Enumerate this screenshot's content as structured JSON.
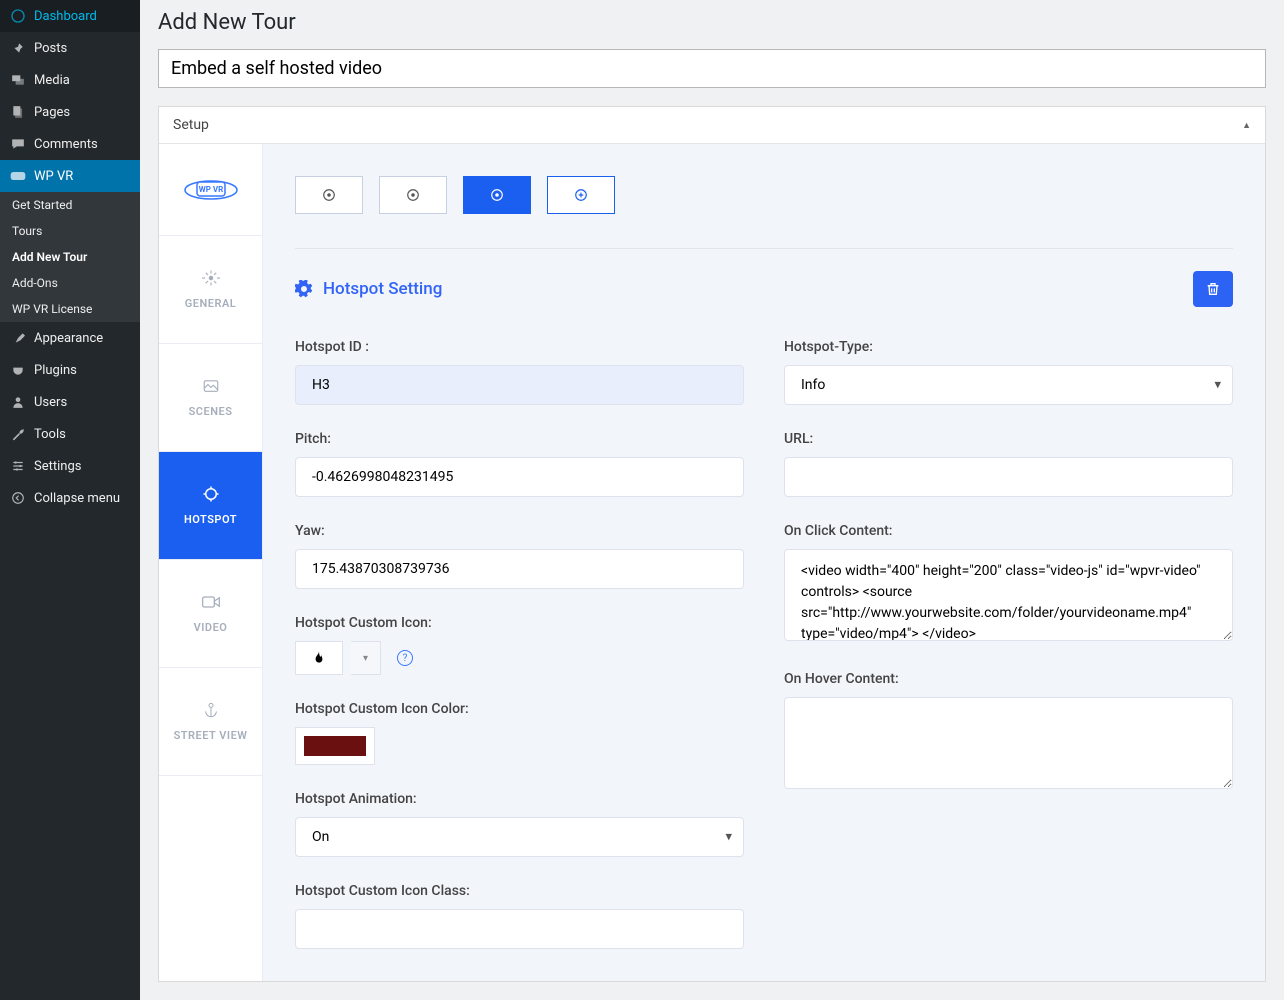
{
  "sidebar": {
    "items": [
      {
        "label": "Dashboard"
      },
      {
        "label": "Posts"
      },
      {
        "label": "Media"
      },
      {
        "label": "Pages"
      },
      {
        "label": "Comments"
      }
    ],
    "active": {
      "label": "WP VR"
    },
    "sub": [
      {
        "label": "Get Started"
      },
      {
        "label": "Tours"
      },
      {
        "label": "Add New Tour"
      },
      {
        "label": "Add-Ons"
      },
      {
        "label": "WP VR License"
      }
    ],
    "items2": [
      {
        "label": "Appearance"
      },
      {
        "label": "Plugins"
      },
      {
        "label": "Users"
      },
      {
        "label": "Tools"
      },
      {
        "label": "Settings"
      },
      {
        "label": "Collapse menu"
      }
    ]
  },
  "page": {
    "title": "Add New Tour",
    "post_title": "Embed a self hosted video"
  },
  "panel": {
    "header": "Setup"
  },
  "tabs": {
    "logo_text": "WP VR",
    "general": "GENERAL",
    "scenes": "SCENES",
    "hotspot": "HOTSPOT",
    "video": "VIDEO",
    "streetview": "STREET VIEW"
  },
  "form": {
    "section_title": "Hotspot Setting",
    "hotspot_id_label": "Hotspot ID :",
    "hotspot_id_value": "H3",
    "pitch_label": "Pitch:",
    "pitch_value": "-0.4626998048231495",
    "yaw_label": "Yaw:",
    "yaw_value": "175.43870308739736",
    "icon_label": "Hotspot Custom Icon:",
    "icon_color_label": "Hotspot Custom Icon Color:",
    "icon_color_value": "#6b1010",
    "animation_label": "Hotspot Animation:",
    "animation_value": "On",
    "icon_class_label": "Hotspot Custom Icon Class:",
    "icon_class_value": "",
    "type_label": "Hotspot-Type:",
    "type_value": "Info",
    "url_label": "URL:",
    "url_value": "",
    "onclick_label": "On Click Content:",
    "onclick_value": "<video width=\"400\" height=\"200\" class=\"video-js\" id=\"wpvr-video\" controls> <source src=\"http://www.yourwebsite.com/folder/yourvideoname.mp4\" type=\"video/mp4\"> </video>",
    "onhover_label": "On Hover Content:",
    "onhover_value": ""
  }
}
